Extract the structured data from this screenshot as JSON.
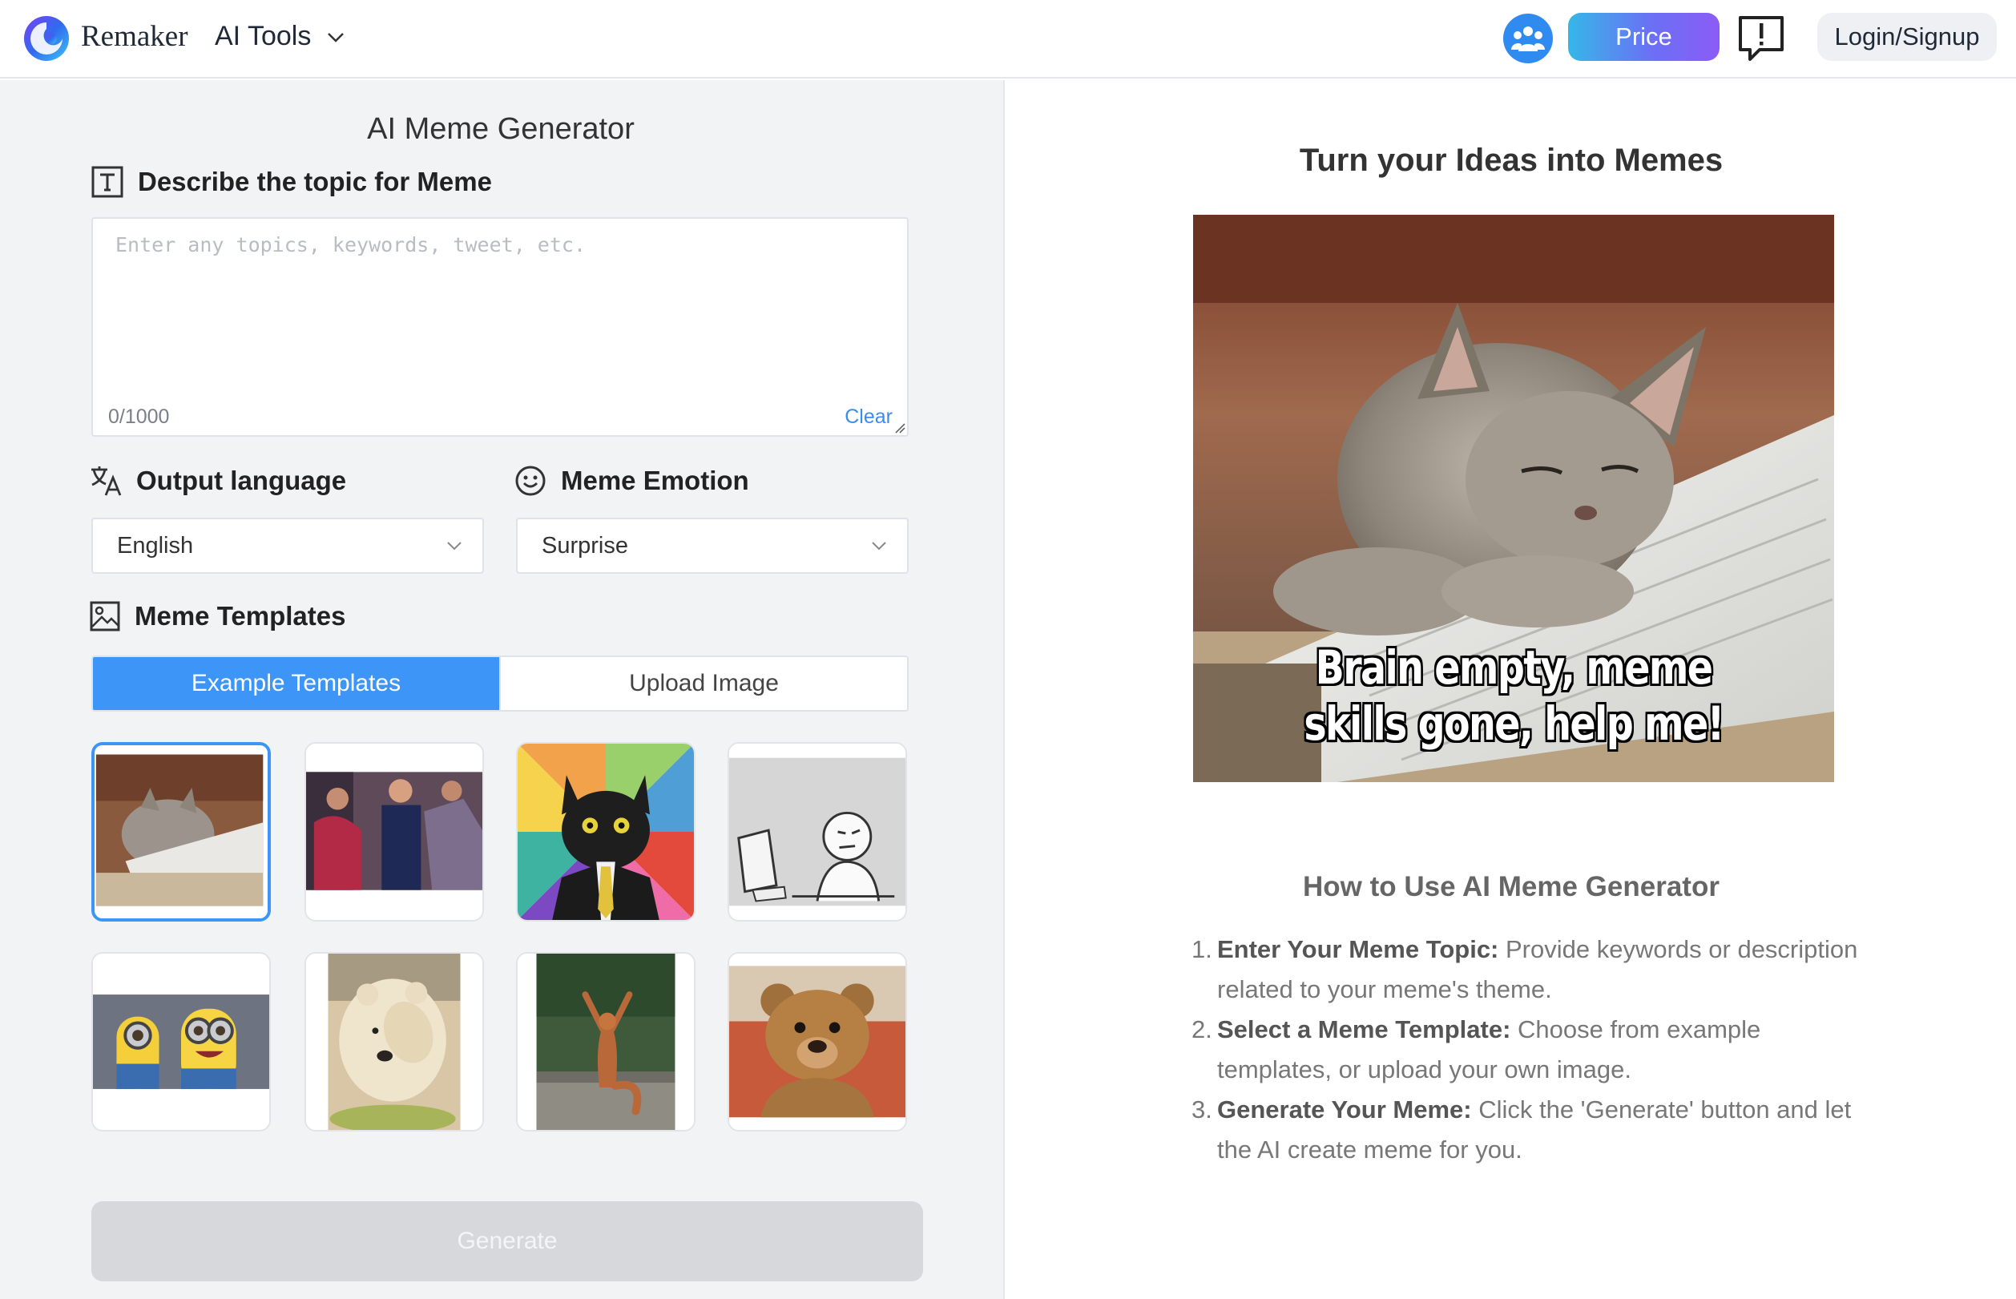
{
  "header": {
    "brand": "Remaker",
    "menu_label": "AI Tools",
    "price_label": "Price",
    "login_label": "Login/Signup"
  },
  "form": {
    "title": "AI Meme Generator",
    "topic_heading": "Describe the topic for Meme",
    "topic_placeholder": "Enter any topics, keywords, tweet, etc.",
    "topic_value": "",
    "char_count": "0/1000",
    "clear_label": "Clear",
    "language_heading": "Output language",
    "language_value": "English",
    "emotion_heading": "Meme Emotion",
    "emotion_value": "Surprise",
    "templates_heading": "Meme Templates",
    "tab_examples": "Example Templates",
    "tab_upload": "Upload Image",
    "generate_label": "Generate"
  },
  "templates": [
    {
      "name": "sleepy-kitten-keyboard",
      "selected": true
    },
    {
      "name": "man-in-crowd-vest",
      "selected": false
    },
    {
      "name": "business-cat",
      "selected": false
    },
    {
      "name": "computer-guy-sketch",
      "selected": false
    },
    {
      "name": "minions",
      "selected": false
    },
    {
      "name": "facepalm-polar-bear",
      "selected": false
    },
    {
      "name": "cheering-squirrel",
      "selected": false
    },
    {
      "name": "ted-bear",
      "selected": false
    }
  ],
  "preview": {
    "title": "Turn your Ideas into Memes",
    "caption_line1": "Brain empty, meme",
    "caption_line2": "skills gone, help me!"
  },
  "howto": {
    "title": "How to Use AI Meme Generator",
    "steps": [
      {
        "num": "1.",
        "bold": "Enter Your Meme Topic:",
        "text": " Provide keywords or description related to your meme's theme."
      },
      {
        "num": "2.",
        "bold": "Select a Meme Template:",
        "text": " Choose from example templates, or upload your own image."
      },
      {
        "num": "3.",
        "bold": "Generate Your Meme:",
        "text": " Click the 'Generate' button and let the AI create meme for you."
      }
    ]
  },
  "colors": {
    "accent": "#3d95f7",
    "price_gradient_start": "#35b7e8",
    "price_gradient_end": "#8b5cf6",
    "panel_bg": "#f2f3f5"
  }
}
